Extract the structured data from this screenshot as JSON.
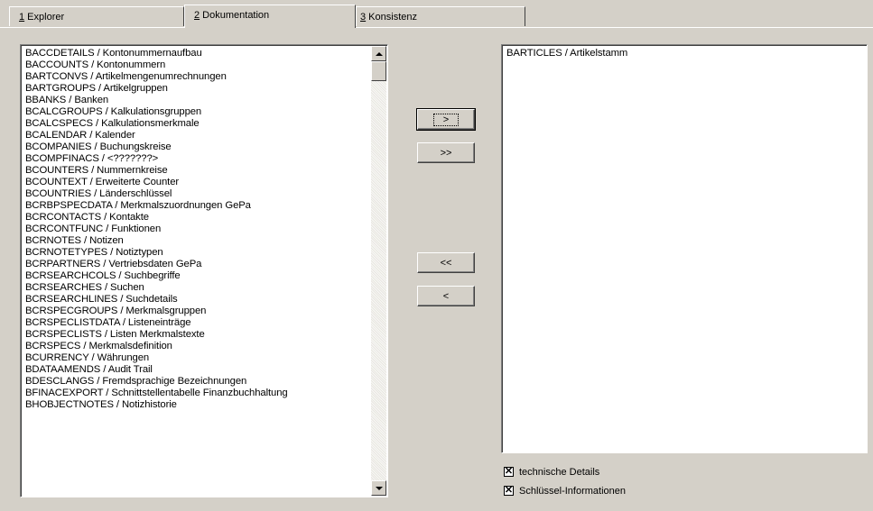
{
  "tabs": [
    {
      "accel": "1",
      "label": " Explorer"
    },
    {
      "accel": "2",
      "label": " Dokumentation"
    },
    {
      "accel": "3",
      "label": " Konsistenz"
    }
  ],
  "active_tab": 1,
  "left_list": {
    "items": [
      "BACCDETAILS / Kontonummernaufbau",
      "BACCOUNTS / Kontonummern",
      "BARTCONVS / Artikelmengenumrechnungen",
      "BARTGROUPS / Artikelgruppen",
      "BBANKS / Banken",
      "BCALCGROUPS / Kalkulationsgruppen",
      "BCALCSPECS / Kalkulationsmerkmale",
      "BCALENDAR / Kalender",
      "BCOMPANIES / Buchungskreise",
      "BCOMPFINACS / <???????>",
      "BCOUNTERS / Nummernkreise",
      "BCOUNTEXT / Erweiterte Counter",
      "BCOUNTRIES / Länderschlüssel",
      "BCRBPSPECDATA / Merkmalszuordnungen GePa",
      "BCRCONTACTS / Kontakte",
      "BCRCONTFUNC / Funktionen",
      "BCRNOTES / Notizen",
      "BCRNOTETYPES / Notiztypen",
      "BCRPARTNERS / Vertriebsdaten GePa",
      "BCRSEARCHCOLS / Suchbegriffe",
      "BCRSEARCHES / Suchen",
      "BCRSEARCHLINES / Suchdetails",
      "BCRSPECGROUPS / Merkmalsgruppen",
      "BCRSPECLISTDATA / Listeneinträge",
      "BCRSPECLISTS / Listen Merkmalstexte",
      "BCRSPECS / Merkmalsdefinition",
      "BCURRENCY / Währungen",
      "BDATAAMENDS / Audit Trail",
      "BDESCLANGS / Fremdsprachige Bezeichnungen",
      "BFINACEXPORT / Schnittstellentabelle Finanzbuchhaltung",
      "BHOBJECTNOTES / Notizhistorie"
    ]
  },
  "right_list": {
    "items": [
      "BARTICLES / Artikelstamm"
    ]
  },
  "buttons": {
    "add": ">",
    "add_all": ">>",
    "remove_all": "<<",
    "remove": "<"
  },
  "checkboxes": [
    {
      "label": "technische Details",
      "checked": true
    },
    {
      "label": "Schlüssel-Informationen",
      "checked": true
    }
  ]
}
